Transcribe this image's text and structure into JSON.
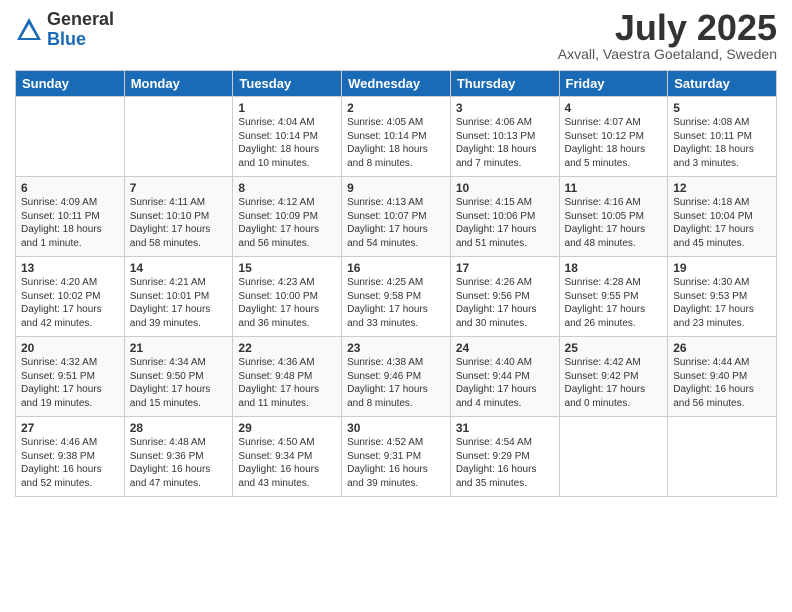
{
  "logo": {
    "general": "General",
    "blue": "Blue"
  },
  "title": "July 2025",
  "location": "Axvall, Vaestra Goetaland, Sweden",
  "headers": [
    "Sunday",
    "Monday",
    "Tuesday",
    "Wednesday",
    "Thursday",
    "Friday",
    "Saturday"
  ],
  "weeks": [
    [
      {
        "day": "",
        "info": ""
      },
      {
        "day": "",
        "info": ""
      },
      {
        "day": "1",
        "info": "Sunrise: 4:04 AM\nSunset: 10:14 PM\nDaylight: 18 hours\nand 10 minutes."
      },
      {
        "day": "2",
        "info": "Sunrise: 4:05 AM\nSunset: 10:14 PM\nDaylight: 18 hours\nand 8 minutes."
      },
      {
        "day": "3",
        "info": "Sunrise: 4:06 AM\nSunset: 10:13 PM\nDaylight: 18 hours\nand 7 minutes."
      },
      {
        "day": "4",
        "info": "Sunrise: 4:07 AM\nSunset: 10:12 PM\nDaylight: 18 hours\nand 5 minutes."
      },
      {
        "day": "5",
        "info": "Sunrise: 4:08 AM\nSunset: 10:11 PM\nDaylight: 18 hours\nand 3 minutes."
      }
    ],
    [
      {
        "day": "6",
        "info": "Sunrise: 4:09 AM\nSunset: 10:11 PM\nDaylight: 18 hours\nand 1 minute."
      },
      {
        "day": "7",
        "info": "Sunrise: 4:11 AM\nSunset: 10:10 PM\nDaylight: 17 hours\nand 58 minutes."
      },
      {
        "day": "8",
        "info": "Sunrise: 4:12 AM\nSunset: 10:09 PM\nDaylight: 17 hours\nand 56 minutes."
      },
      {
        "day": "9",
        "info": "Sunrise: 4:13 AM\nSunset: 10:07 PM\nDaylight: 17 hours\nand 54 minutes."
      },
      {
        "day": "10",
        "info": "Sunrise: 4:15 AM\nSunset: 10:06 PM\nDaylight: 17 hours\nand 51 minutes."
      },
      {
        "day": "11",
        "info": "Sunrise: 4:16 AM\nSunset: 10:05 PM\nDaylight: 17 hours\nand 48 minutes."
      },
      {
        "day": "12",
        "info": "Sunrise: 4:18 AM\nSunset: 10:04 PM\nDaylight: 17 hours\nand 45 minutes."
      }
    ],
    [
      {
        "day": "13",
        "info": "Sunrise: 4:20 AM\nSunset: 10:02 PM\nDaylight: 17 hours\nand 42 minutes."
      },
      {
        "day": "14",
        "info": "Sunrise: 4:21 AM\nSunset: 10:01 PM\nDaylight: 17 hours\nand 39 minutes."
      },
      {
        "day": "15",
        "info": "Sunrise: 4:23 AM\nSunset: 10:00 PM\nDaylight: 17 hours\nand 36 minutes."
      },
      {
        "day": "16",
        "info": "Sunrise: 4:25 AM\nSunset: 9:58 PM\nDaylight: 17 hours\nand 33 minutes."
      },
      {
        "day": "17",
        "info": "Sunrise: 4:26 AM\nSunset: 9:56 PM\nDaylight: 17 hours\nand 30 minutes."
      },
      {
        "day": "18",
        "info": "Sunrise: 4:28 AM\nSunset: 9:55 PM\nDaylight: 17 hours\nand 26 minutes."
      },
      {
        "day": "19",
        "info": "Sunrise: 4:30 AM\nSunset: 9:53 PM\nDaylight: 17 hours\nand 23 minutes."
      }
    ],
    [
      {
        "day": "20",
        "info": "Sunrise: 4:32 AM\nSunset: 9:51 PM\nDaylight: 17 hours\nand 19 minutes."
      },
      {
        "day": "21",
        "info": "Sunrise: 4:34 AM\nSunset: 9:50 PM\nDaylight: 17 hours\nand 15 minutes."
      },
      {
        "day": "22",
        "info": "Sunrise: 4:36 AM\nSunset: 9:48 PM\nDaylight: 17 hours\nand 11 minutes."
      },
      {
        "day": "23",
        "info": "Sunrise: 4:38 AM\nSunset: 9:46 PM\nDaylight: 17 hours\nand 8 minutes."
      },
      {
        "day": "24",
        "info": "Sunrise: 4:40 AM\nSunset: 9:44 PM\nDaylight: 17 hours\nand 4 minutes."
      },
      {
        "day": "25",
        "info": "Sunrise: 4:42 AM\nSunset: 9:42 PM\nDaylight: 17 hours\nand 0 minutes."
      },
      {
        "day": "26",
        "info": "Sunrise: 4:44 AM\nSunset: 9:40 PM\nDaylight: 16 hours\nand 56 minutes."
      }
    ],
    [
      {
        "day": "27",
        "info": "Sunrise: 4:46 AM\nSunset: 9:38 PM\nDaylight: 16 hours\nand 52 minutes."
      },
      {
        "day": "28",
        "info": "Sunrise: 4:48 AM\nSunset: 9:36 PM\nDaylight: 16 hours\nand 47 minutes."
      },
      {
        "day": "29",
        "info": "Sunrise: 4:50 AM\nSunset: 9:34 PM\nDaylight: 16 hours\nand 43 minutes."
      },
      {
        "day": "30",
        "info": "Sunrise: 4:52 AM\nSunset: 9:31 PM\nDaylight: 16 hours\nand 39 minutes."
      },
      {
        "day": "31",
        "info": "Sunrise: 4:54 AM\nSunset: 9:29 PM\nDaylight: 16 hours\nand 35 minutes."
      },
      {
        "day": "",
        "info": ""
      },
      {
        "day": "",
        "info": ""
      }
    ]
  ]
}
